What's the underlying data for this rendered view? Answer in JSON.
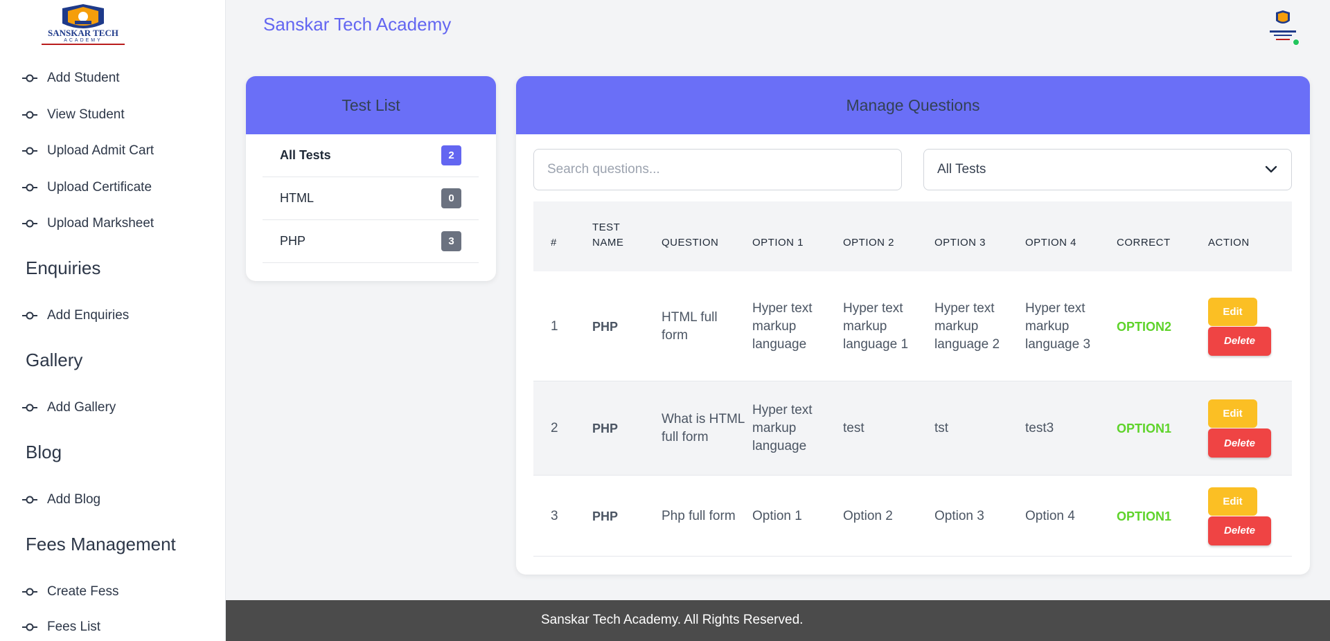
{
  "app": {
    "brand": "Sanskar Tech Academy"
  },
  "sidebar": {
    "logo_alt": "Sanskar Tech Academy logo",
    "logo_text": "SANSKAR TECH",
    "logo_sub": "ACADEMY",
    "items": [
      {
        "label": "Add Student"
      },
      {
        "label": "View Student"
      },
      {
        "label": "Upload Admit Cart"
      },
      {
        "label": "Upload Certificate"
      },
      {
        "label": "Upload Marksheet"
      }
    ],
    "sections": [
      {
        "title": "Enquiries",
        "items": [
          {
            "label": "Add Enquiries"
          }
        ]
      },
      {
        "title": "Gallery",
        "items": [
          {
            "label": "Add Gallery"
          }
        ]
      },
      {
        "title": "Blog",
        "items": [
          {
            "label": "Add Blog"
          }
        ]
      },
      {
        "title": "Fees Management",
        "items": [
          {
            "label": "Create Fess"
          },
          {
            "label": "Fees List"
          }
        ]
      }
    ]
  },
  "test_list": {
    "title": "Test List",
    "items": [
      {
        "name": "All Tests",
        "count": "2",
        "color": "#6366f1",
        "active": true
      },
      {
        "name": "HTML",
        "count": "0",
        "color": "#6b7280",
        "active": false
      },
      {
        "name": "PHP",
        "count": "3",
        "color": "#6b7280",
        "active": false
      }
    ]
  },
  "manage": {
    "title": "Manage Questions",
    "search_placeholder": "Search questions...",
    "select_value": "All Tests",
    "headers": [
      "#",
      "TEST NAME",
      "QUESTION",
      "OPTION 1",
      "OPTION 2",
      "OPTION 3",
      "OPTION 4",
      "CORRECT",
      "ACTION"
    ],
    "edit_label": "Edit",
    "delete_label": "Delete",
    "rows": [
      {
        "num": "1",
        "test": "PHP",
        "question": "HTML full form",
        "o1": "Hyper text markup language",
        "o2": "Hyper text markup language 1",
        "o3": "Hyper text markup language 2",
        "o4": "Hyper text markup language 3",
        "correct": "OPTION2"
      },
      {
        "num": "2",
        "test": "PHP",
        "question": "What is HTML full form",
        "o1": "Hyper text markup language",
        "o2": "test",
        "o3": "tst",
        "o4": "test3",
        "correct": "OPTION1"
      },
      {
        "num": "3",
        "test": "PHP",
        "question": "Php full form",
        "o1": "Option 1",
        "o2": "Option 2",
        "o3": "Option 3",
        "o4": "Option 4",
        "correct": "OPTION1"
      }
    ]
  },
  "footer": {
    "text": "Sanskar Tech Academy. All Rights Reserved."
  },
  "colors": {
    "accent": "#6366f1",
    "header": "#6a6ff7",
    "edit": "#fbbf24",
    "delete": "#ef4444",
    "correct": "#5ed32a",
    "footer": "#4b4b4b"
  }
}
